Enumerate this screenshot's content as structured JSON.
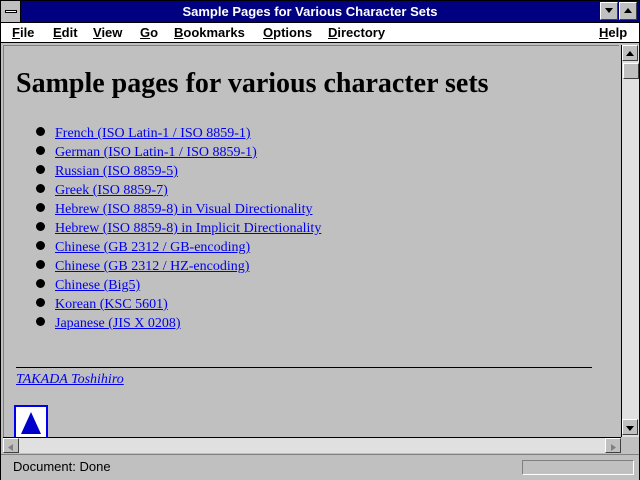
{
  "window": {
    "title": "Sample Pages for Various Character Sets"
  },
  "menu": [
    "File",
    "Edit",
    "View",
    "Go",
    "Bookmarks",
    "Options",
    "Directory"
  ],
  "help_label": "Help",
  "page": {
    "heading": "Sample pages for various character sets",
    "links": [
      "French (ISO Latin-1 / ISO 8859-1)",
      "German (ISO Latin-1 / ISO 8859-1)",
      "Russian (ISO 8859-5)",
      "Greek (ISO 8859-7)",
      "Hebrew (ISO 8859-8) in Visual Directionality",
      "Hebrew (ISO 8859-8) in Implicit Directionality",
      "Chinese (GB 2312 / GB-encoding)",
      "Chinese (GB 2312 / HZ-encoding)",
      "Chinese (Big5)",
      "Korean (KSC 5601)",
      "Japanese (JIS X 0208)"
    ],
    "author": "TAKADA Toshihiro"
  },
  "status": {
    "text": "Document: Done"
  },
  "colors": {
    "titlebar": "#000080",
    "link": "#0000ee",
    "background": "#c0c0c0"
  }
}
